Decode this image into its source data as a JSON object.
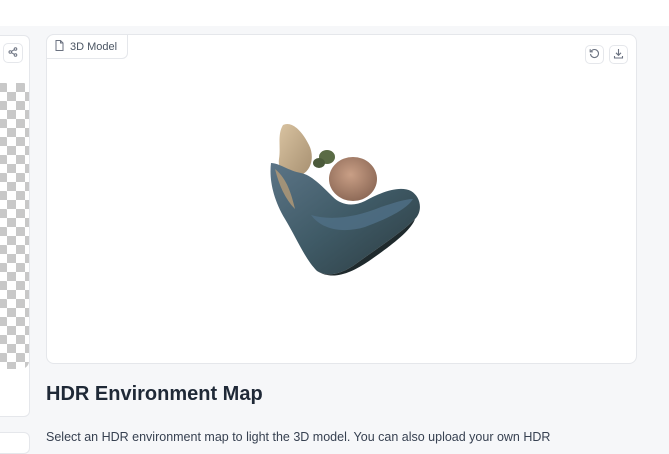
{
  "model_viewer": {
    "label": "3D Model",
    "icons": {
      "label": "file-icon",
      "reset": "reset-view-icon",
      "download": "download-icon"
    }
  },
  "left_panel": {
    "share_icon": "share-icon"
  },
  "environment_section": {
    "heading": "HDR Environment Map",
    "description": "Select an HDR environment map to light the 3D model. You can also upload your own HDR"
  },
  "colors": {
    "page_background": "#f6f7f9",
    "panel_background": "#ffffff",
    "border": "#e5e7eb",
    "heading_text": "#1f2937"
  }
}
